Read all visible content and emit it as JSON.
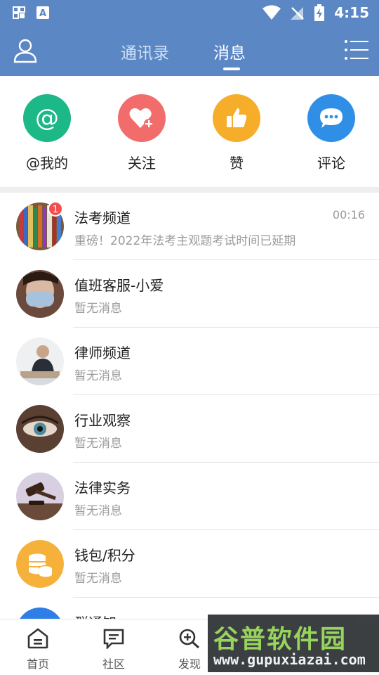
{
  "status_bar": {
    "time": "4:15"
  },
  "header": {
    "tabs": [
      {
        "label": "通讯录",
        "active": false
      },
      {
        "label": "消息",
        "active": true
      }
    ]
  },
  "quick_actions": [
    {
      "label": "@我的",
      "icon": "at-icon",
      "color": "#1cb887"
    },
    {
      "label": "关注",
      "icon": "heart-plus-icon",
      "color": "#f36c6c"
    },
    {
      "label": "赞",
      "icon": "thumbs-up-icon",
      "color": "#f6ad2a"
    },
    {
      "label": "评论",
      "icon": "chat-bubble-icon",
      "color": "#2f8fe6"
    }
  ],
  "conversations": [
    {
      "title": "法考频道",
      "subtitle": "重磅！2022年法考主观题考试时间已延期",
      "time": "00:16",
      "badge": "1"
    },
    {
      "title": "值班客服-小爱",
      "subtitle": "暂无消息"
    },
    {
      "title": "律师频道",
      "subtitle": "暂无消息"
    },
    {
      "title": "行业观察",
      "subtitle": "暂无消息"
    },
    {
      "title": "法律实务",
      "subtitle": "暂无消息"
    },
    {
      "title": "钱包/积分",
      "subtitle": "暂无消息"
    },
    {
      "title": "群通知",
      "subtitle": ""
    }
  ],
  "bottom_nav": [
    {
      "label": "首页",
      "icon": "home-icon"
    },
    {
      "label": "社区",
      "icon": "community-icon"
    },
    {
      "label": "发现",
      "icon": "discover-icon"
    }
  ],
  "watermark": {
    "title": "谷普软件园",
    "url": "www.gupuxiazai.com"
  },
  "colors": {
    "primary": "#5b87c4",
    "badge": "#f25050"
  }
}
